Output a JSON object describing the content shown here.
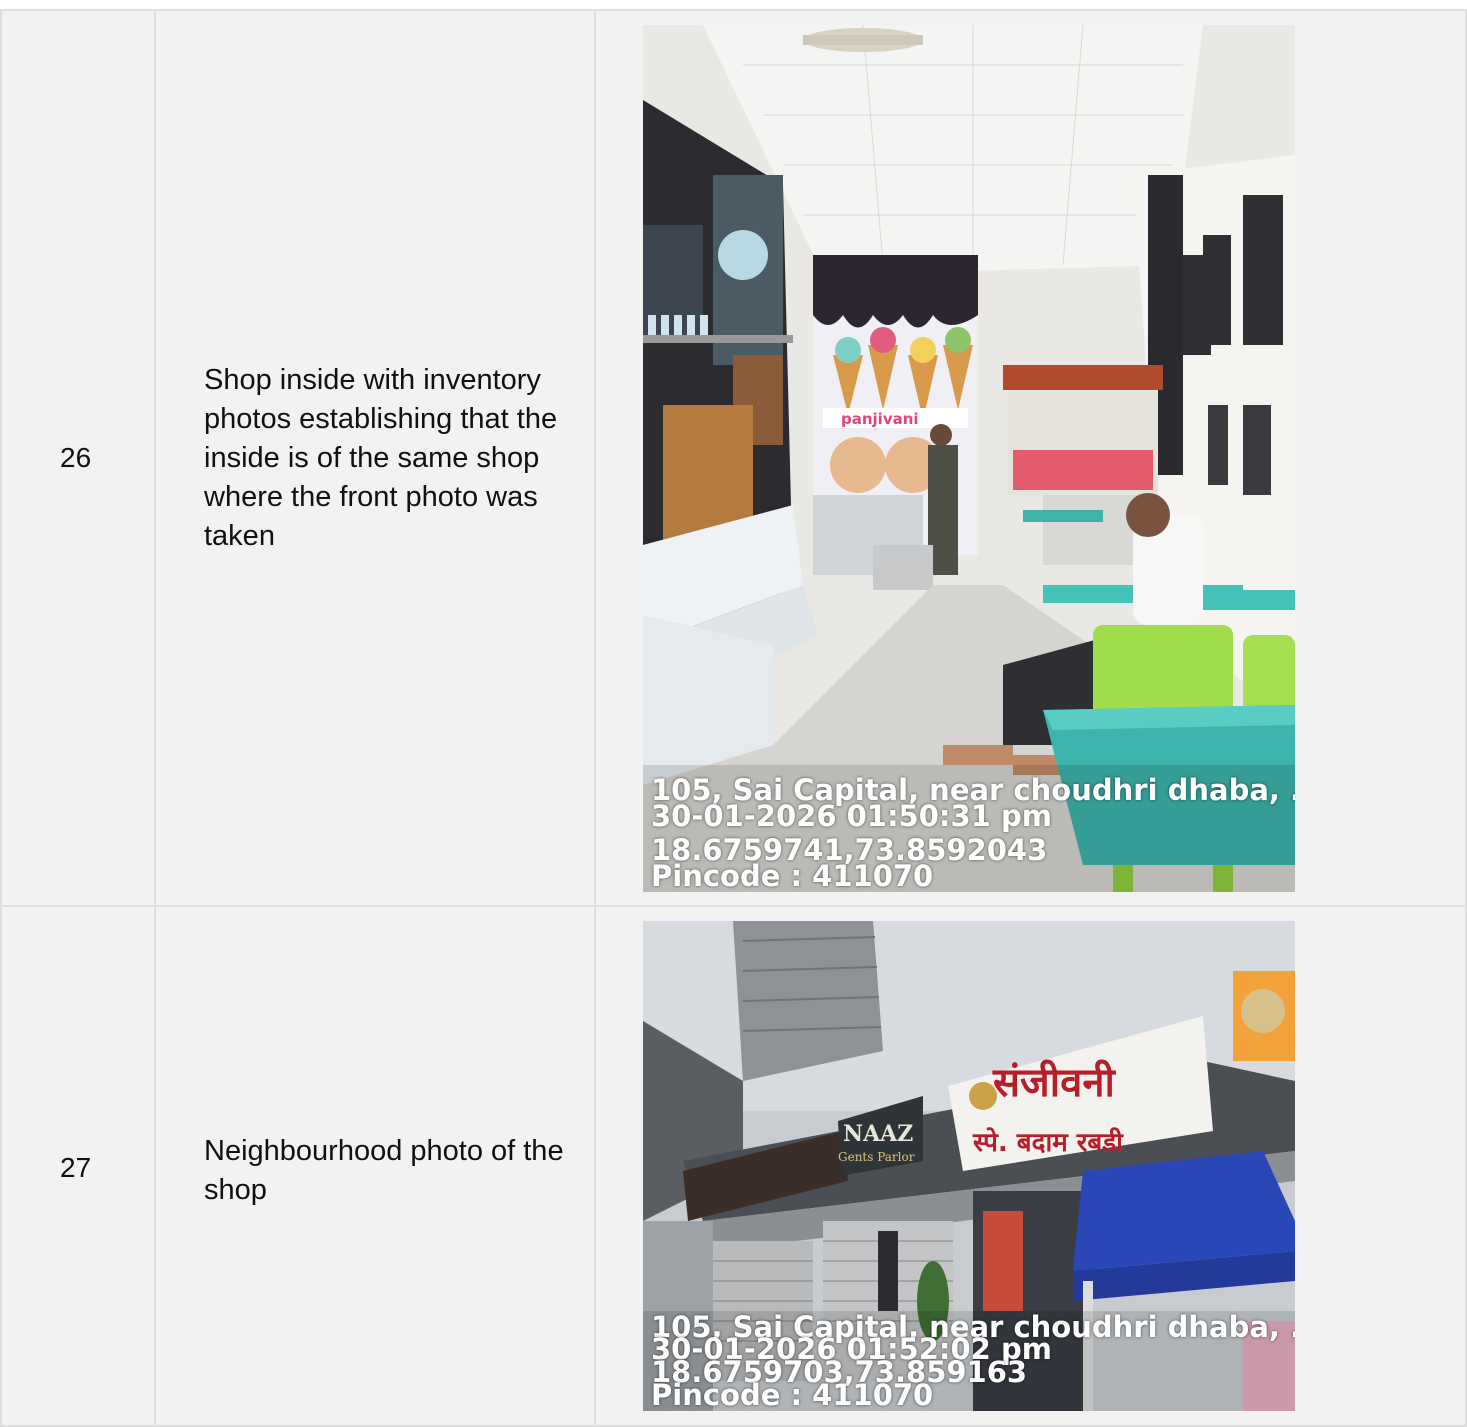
{
  "rows": [
    {
      "number": "26",
      "description": "Shop inside with inventory photos establishing that the inside is of the same shop where the front photo was taken",
      "photo": {
        "address": "105, Sai Capital, near choudhri dhaba, ...",
        "datetime": "30-01-2026 01:50:31 pm",
        "coordinates": "18.6759741,73.8592043",
        "pincode": "Pincode : 411070",
        "poster_brand": "panjivani"
      }
    },
    {
      "number": "27",
      "description": "Neighbourhood photo of the shop",
      "photo": {
        "address": "105, Sai Capital, near choudhri dhaba, ...",
        "datetime": "30-01-2026 01:52:02 pm",
        "coordinates": "18.6759703,73.859163",
        "pincode": "Pincode : 411070",
        "sign_naaz": "NAAZ",
        "sign_naaz_sub": "Gents Parlor",
        "sign_marathi": "संजीवनी",
        "sign_marathi_sub": "स्पे. बदाम रबडी"
      }
    }
  ],
  "colors": {
    "cell_bg": "#f2f2f2",
    "cell_border": "#dedede",
    "stamp_text": "#ffffff"
  }
}
